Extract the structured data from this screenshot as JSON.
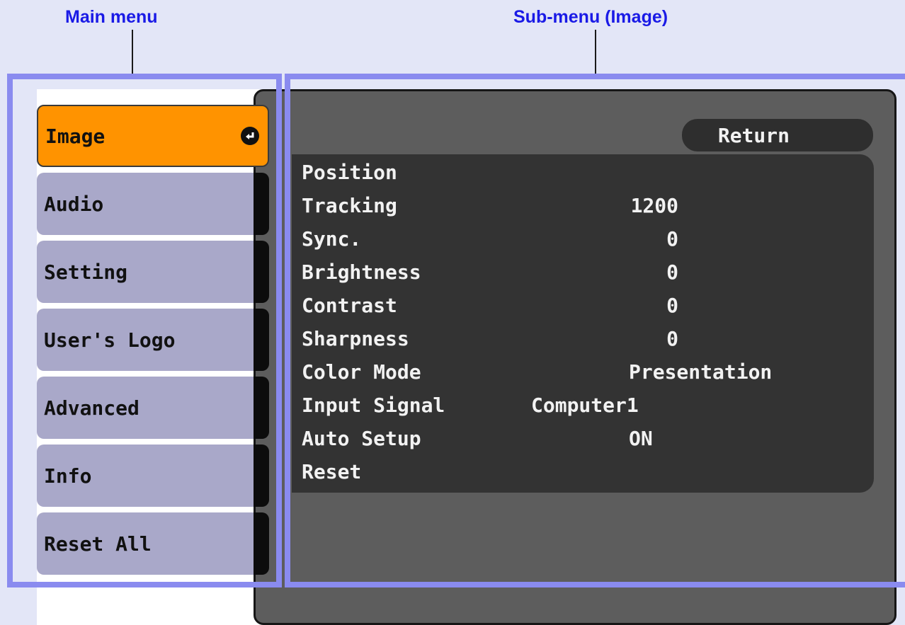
{
  "callouts": {
    "main_menu": "Main menu",
    "sub_menu": "Sub-menu (Image)"
  },
  "main_menu": {
    "items": [
      {
        "label": "Image",
        "active": true
      },
      {
        "label": "Audio"
      },
      {
        "label": "Setting"
      },
      {
        "label": "User's Logo"
      },
      {
        "label": "Advanced"
      },
      {
        "label": "Info"
      },
      {
        "label": "Reset All"
      }
    ],
    "active_icon": "enter-icon"
  },
  "sub_menu": {
    "return_label": "Return",
    "items": [
      {
        "name": "Position",
        "value": ""
      },
      {
        "name": "Tracking",
        "value": "1200"
      },
      {
        "name": "Sync.",
        "value": "0"
      },
      {
        "name": "Brightness",
        "value": "0"
      },
      {
        "name": "Contrast",
        "value": "0"
      },
      {
        "name": "Sharpness",
        "value": "0"
      },
      {
        "name": "Color Mode",
        "value": "Presentation"
      },
      {
        "name": "Input Signal",
        "value": "Computer1"
      },
      {
        "name": "Auto Setup",
        "value": "ON"
      },
      {
        "name": "Reset",
        "value": ""
      }
    ]
  },
  "colors": {
    "active_item": "#ff9300",
    "menu_item": "#a9a8c9",
    "frame": "#8a8bef",
    "callout_text": "#1a1ae6",
    "sub_background": "#5d5d5d",
    "sub_list": "#333333"
  }
}
